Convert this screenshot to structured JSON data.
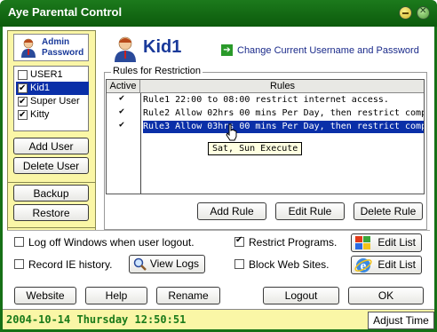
{
  "window": {
    "title": "Aye Parental Control"
  },
  "admin": {
    "label_line1": "Admin",
    "label_line2": "Password"
  },
  "users": [
    {
      "name": "USER1",
      "checked": false,
      "selected": false
    },
    {
      "name": "Kid1",
      "checked": true,
      "selected": true
    },
    {
      "name": "Super User",
      "checked": true,
      "selected": false
    },
    {
      "name": "Kitty",
      "checked": true,
      "selected": false
    }
  ],
  "sidebar": {
    "add_user": "Add User",
    "delete_user": "Delete User",
    "backup": "Backup",
    "restore": "Restore"
  },
  "header": {
    "username": "Kid1",
    "change_link": "Change Current Username and Password"
  },
  "rules": {
    "group_label": "Rules for Restriction",
    "col_active": "Active",
    "col_rules": "Rules",
    "items": [
      {
        "active": true,
        "text": "Rule1 22:00 to 08:00 restrict internet access.",
        "selected": false
      },
      {
        "active": true,
        "text": "Rule2 Allow 02hrs 00 mins Per Day, then restrict computer acc",
        "selected": false
      },
      {
        "active": true,
        "text": "Rule3 Allow 03hrs 00 mins Per Day, then restrict computer acc",
        "selected": true
      }
    ],
    "tooltip": "Sat, Sun Execute",
    "add_rule": "Add Rule",
    "edit_rule": "Edit Rule",
    "delete_rule": "Delete Rule"
  },
  "options": {
    "logoff_label": "Log off Windows when user logout.",
    "logoff_checked": false,
    "record_ie_label": "Record IE history.",
    "record_ie_checked": false,
    "view_logs": "View Logs",
    "restrict_programs_label": "Restrict Programs.",
    "restrict_programs_checked": true,
    "block_sites_label": "Block Web Sites.",
    "block_sites_checked": false,
    "edit_list_1": "Edit List",
    "edit_list_2": "Edit List"
  },
  "footer": {
    "website": "Website",
    "help": "Help",
    "rename": "Rename",
    "logout": "Logout",
    "ok": "OK"
  },
  "status": {
    "datetime": "2004-10-14 Thursday 12:50:51",
    "adjust_time": "Adjust Time"
  },
  "colors": {
    "titlebar": "#167016",
    "sidebar_bg": "#faf6a6",
    "selection": "#0a2fa8",
    "status_text": "#1a7a1a"
  }
}
